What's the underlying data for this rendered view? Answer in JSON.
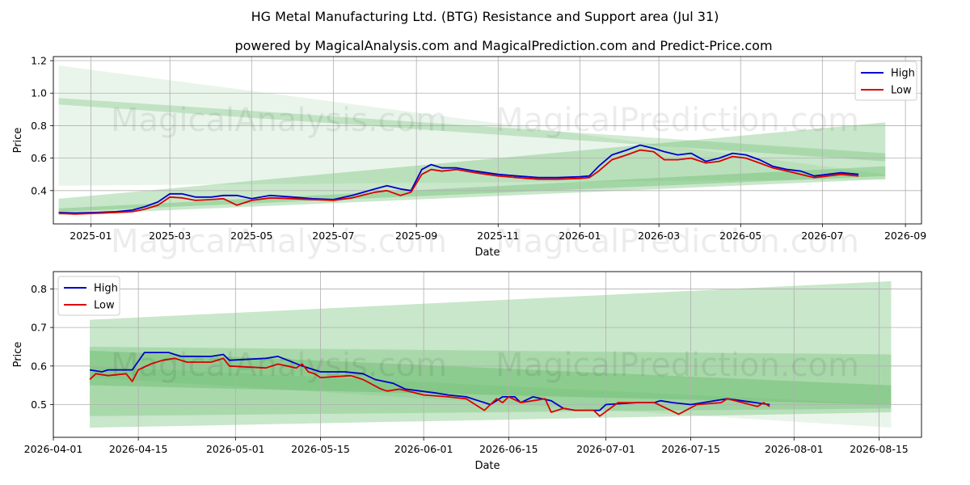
{
  "title": "HG Metal Manufacturing Ltd. (BTG) Resistance and Support area (Jul 31)",
  "subtitle": "powered by MagicalAnalysis.com and MagicalPrediction.com and Predict-Price.com",
  "watermarks": [
    "MagicalAnalysis.com",
    "MagicalPrediction.com"
  ],
  "colors": {
    "high": "#0000cc",
    "low": "#dd0000",
    "band": "#4caf50"
  },
  "chart_data": [
    {
      "type": "line",
      "xlabel": "Date",
      "ylabel": "Price",
      "xlim": [
        "2024-12-04",
        "2026-09-13"
      ],
      "ylim": [
        0.195,
        1.225
      ],
      "x_ticks": [
        "2025-01",
        "2025-03",
        "2025-05",
        "2025-07",
        "2025-09",
        "2025-11",
        "2026-01",
        "2026-03",
        "2026-05",
        "2026-07",
        "2026-09"
      ],
      "x_tick_dates": [
        "2025-01-01",
        "2025-03-01",
        "2025-05-01",
        "2025-07-01",
        "2025-09-01",
        "2025-11-01",
        "2026-01-01",
        "2026-03-01",
        "2026-05-01",
        "2026-07-01",
        "2026-09-01"
      ],
      "y_ticks": [
        0.4,
        0.6,
        0.8,
        1.0,
        1.2
      ],
      "y_tick_labels": [
        "0.4",
        "0.6",
        "0.8",
        "1.0",
        "1.2"
      ],
      "grid": true,
      "legend": "top-right",
      "bands": [
        {
          "start": "2024-12-08",
          "end": "2026-08-17",
          "top_start": 1.17,
          "top_end": 0.5,
          "bottom_start": 0.43,
          "bottom_end": 0.47,
          "opacity": 0.12
        },
        {
          "start": "2024-12-08",
          "end": "2026-08-17",
          "top_start": 0.97,
          "top_end": 0.63,
          "bottom_start": 0.93,
          "bottom_end": 0.58,
          "opacity": 0.25
        },
        {
          "start": "2024-12-08",
          "end": "2026-08-17",
          "top_start": 0.35,
          "top_end": 0.82,
          "bottom_start": 0.27,
          "bottom_end": 0.49,
          "opacity": 0.3
        },
        {
          "start": "2024-12-08",
          "end": "2026-08-17",
          "top_start": 0.29,
          "top_end": 0.55,
          "bottom_start": 0.25,
          "bottom_end": 0.47,
          "opacity": 0.3
        }
      ],
      "series": [
        {
          "name": "High",
          "x": [
            "2024-12-08",
            "2024-12-20",
            "2025-01-05",
            "2025-01-20",
            "2025-02-01",
            "2025-02-10",
            "2025-02-20",
            "2025-03-01",
            "2025-03-10",
            "2025-03-20",
            "2025-04-01",
            "2025-04-10",
            "2025-04-20",
            "2025-05-01",
            "2025-05-15",
            "2025-06-01",
            "2025-06-15",
            "2025-07-01",
            "2025-07-15",
            "2025-08-01",
            "2025-08-10",
            "2025-08-20",
            "2025-08-28",
            "2025-09-05",
            "2025-09-12",
            "2025-09-20",
            "2025-10-01",
            "2025-10-15",
            "2025-11-01",
            "2025-11-15",
            "2025-12-01",
            "2025-12-15",
            "2026-01-01",
            "2026-01-08",
            "2026-01-15",
            "2026-01-25",
            "2026-02-05",
            "2026-02-15",
            "2026-02-25",
            "2026-03-05",
            "2026-03-15",
            "2026-03-25",
            "2026-04-05",
            "2026-04-15",
            "2026-04-25",
            "2026-05-05",
            "2026-05-15",
            "2026-05-25",
            "2026-06-05",
            "2026-06-15",
            "2026-06-25",
            "2026-07-05",
            "2026-07-15",
            "2026-07-28"
          ],
          "values": [
            0.265,
            0.262,
            0.265,
            0.27,
            0.28,
            0.3,
            0.33,
            0.38,
            0.38,
            0.36,
            0.36,
            0.37,
            0.37,
            0.35,
            0.37,
            0.36,
            0.35,
            0.345,
            0.37,
            0.41,
            0.43,
            0.41,
            0.4,
            0.53,
            0.56,
            0.54,
            0.54,
            0.52,
            0.5,
            0.49,
            0.48,
            0.48,
            0.485,
            0.49,
            0.55,
            0.62,
            0.65,
            0.68,
            0.66,
            0.64,
            0.62,
            0.63,
            0.58,
            0.6,
            0.63,
            0.62,
            0.59,
            0.55,
            0.53,
            0.52,
            0.49,
            0.5,
            0.51,
            0.5
          ]
        },
        {
          "name": "Low",
          "x": [
            "2024-12-08",
            "2024-12-20",
            "2025-01-05",
            "2025-01-20",
            "2025-02-01",
            "2025-02-10",
            "2025-02-20",
            "2025-03-01",
            "2025-03-10",
            "2025-03-20",
            "2025-04-01",
            "2025-04-10",
            "2025-04-20",
            "2025-05-01",
            "2025-05-15",
            "2025-06-01",
            "2025-06-15",
            "2025-07-01",
            "2025-07-15",
            "2025-08-01",
            "2025-08-10",
            "2025-08-20",
            "2025-08-28",
            "2025-09-05",
            "2025-09-12",
            "2025-09-20",
            "2025-10-01",
            "2025-10-15",
            "2025-11-01",
            "2025-11-15",
            "2025-12-01",
            "2025-12-15",
            "2026-01-01",
            "2026-01-08",
            "2026-01-15",
            "2026-01-25",
            "2026-02-05",
            "2026-02-15",
            "2026-02-25",
            "2026-03-05",
            "2026-03-15",
            "2026-03-25",
            "2026-04-05",
            "2026-04-15",
            "2026-04-25",
            "2026-05-05",
            "2026-05-15",
            "2026-05-25",
            "2026-06-05",
            "2026-06-15",
            "2026-06-25",
            "2026-07-05",
            "2026-07-15",
            "2026-07-28"
          ],
          "values": [
            0.26,
            0.255,
            0.26,
            0.265,
            0.27,
            0.285,
            0.31,
            0.36,
            0.355,
            0.34,
            0.345,
            0.35,
            0.31,
            0.34,
            0.355,
            0.35,
            0.345,
            0.34,
            0.355,
            0.39,
            0.4,
            0.37,
            0.39,
            0.5,
            0.53,
            0.52,
            0.53,
            0.51,
            0.49,
            0.48,
            0.47,
            0.47,
            0.475,
            0.48,
            0.52,
            0.59,
            0.62,
            0.65,
            0.64,
            0.59,
            0.59,
            0.6,
            0.57,
            0.58,
            0.61,
            0.6,
            0.57,
            0.54,
            0.52,
            0.5,
            0.48,
            0.49,
            0.5,
            0.49
          ]
        }
      ]
    },
    {
      "type": "line",
      "xlabel": "Date",
      "ylabel": "Price",
      "xlim": [
        "2026-04-01",
        "2026-08-22"
      ],
      "ylim": [
        0.415,
        0.845
      ],
      "x_ticks": [
        "2026-04-01",
        "2026-04-15",
        "2026-05-01",
        "2026-05-15",
        "2026-06-01",
        "2026-06-15",
        "2026-07-01",
        "2026-07-15",
        "2026-08-01",
        "2026-08-15"
      ],
      "x_tick_dates": [
        "2026-04-01",
        "2026-04-15",
        "2026-05-01",
        "2026-05-15",
        "2026-06-01",
        "2026-06-15",
        "2026-07-01",
        "2026-07-15",
        "2026-08-01",
        "2026-08-15"
      ],
      "y_ticks": [
        0.5,
        0.6,
        0.7,
        0.8
      ],
      "y_tick_labels": [
        "0.5",
        "0.6",
        "0.7",
        "0.8"
      ],
      "grid": true,
      "legend": "top-left",
      "bands": [
        {
          "start": "2026-04-07",
          "end": "2026-08-17",
          "top_start": 0.72,
          "top_end": 0.82,
          "bottom_start": 0.44,
          "bottom_end": 0.48,
          "opacity": 0.3
        },
        {
          "start": "2026-04-07",
          "end": "2026-08-17",
          "top_start": 0.65,
          "top_end": 0.63,
          "bottom_start": 0.47,
          "bottom_end": 0.49,
          "opacity": 0.25
        },
        {
          "start": "2026-04-07",
          "end": "2026-08-17",
          "top_start": 0.64,
          "top_end": 0.55,
          "bottom_start": 0.55,
          "bottom_end": 0.5,
          "opacity": 0.3
        },
        {
          "start": "2026-04-07",
          "end": "2026-08-17",
          "top_start": 0.6,
          "top_end": 0.5,
          "bottom_start": 0.57,
          "bottom_end": 0.44,
          "opacity": 0.12
        }
      ],
      "series": [
        {
          "name": "High",
          "x": [
            "2026-04-07",
            "2026-04-09",
            "2026-04-10",
            "2026-04-14",
            "2026-04-16",
            "2026-04-20",
            "2026-04-22",
            "2026-04-27",
            "2026-04-29",
            "2026-04-30",
            "2026-05-06",
            "2026-05-08",
            "2026-05-12",
            "2026-05-15",
            "2026-05-19",
            "2026-05-22",
            "2026-05-24",
            "2026-05-27",
            "2026-05-29",
            "2026-06-03",
            "2026-06-05",
            "2026-06-08",
            "2026-06-10",
            "2026-06-12",
            "2026-06-14",
            "2026-06-15",
            "2026-06-16",
            "2026-06-17",
            "2026-06-19",
            "2026-06-22",
            "2026-06-23",
            "2026-06-24",
            "2026-06-26",
            "2026-06-30",
            "2026-07-01",
            "2026-07-06",
            "2026-07-09",
            "2026-07-10",
            "2026-07-12",
            "2026-07-15",
            "2026-07-21",
            "2026-07-28"
          ],
          "values": [
            0.59,
            0.585,
            0.59,
            0.59,
            0.635,
            0.635,
            0.625,
            0.625,
            0.63,
            0.615,
            0.62,
            0.625,
            0.6,
            0.585,
            0.585,
            0.58,
            0.565,
            0.555,
            0.54,
            0.53,
            0.525,
            0.52,
            0.51,
            0.5,
            0.52,
            0.52,
            0.52,
            0.505,
            0.52,
            0.51,
            0.5,
            0.49,
            0.485,
            0.485,
            0.5,
            0.505,
            0.505,
            0.51,
            0.505,
            0.5,
            0.515,
            0.5
          ]
        },
        {
          "name": "Low",
          "x": [
            "2026-04-07",
            "2026-04-08",
            "2026-04-10",
            "2026-04-13",
            "2026-04-14",
            "2026-04-15",
            "2026-04-17",
            "2026-04-19",
            "2026-04-21",
            "2026-04-23",
            "2026-04-27",
            "2026-04-29",
            "2026-04-30",
            "2026-05-06",
            "2026-05-08",
            "2026-05-11",
            "2026-05-12",
            "2026-05-13",
            "2026-05-14",
            "2026-05-15",
            "2026-05-20",
            "2026-05-22",
            "2026-05-25",
            "2026-05-26",
            "2026-05-28",
            "2026-06-01",
            "2026-06-05",
            "2026-06-08",
            "2026-06-09",
            "2026-06-11",
            "2026-06-13",
            "2026-06-14",
            "2026-06-15",
            "2026-06-17",
            "2026-06-21",
            "2026-06-22",
            "2026-06-24",
            "2026-06-26",
            "2026-06-29",
            "2026-06-30",
            "2026-07-03",
            "2026-07-09",
            "2026-07-13",
            "2026-07-16",
            "2026-07-20",
            "2026-07-21",
            "2026-07-26",
            "2026-07-27",
            "2026-07-28"
          ],
          "values": [
            0.565,
            0.58,
            0.575,
            0.58,
            0.56,
            0.59,
            0.605,
            0.615,
            0.62,
            0.61,
            0.61,
            0.62,
            0.6,
            0.595,
            0.605,
            0.595,
            0.605,
            0.585,
            0.58,
            0.57,
            0.575,
            0.565,
            0.54,
            0.535,
            0.54,
            0.525,
            0.52,
            0.515,
            0.505,
            0.485,
            0.515,
            0.505,
            0.52,
            0.505,
            0.515,
            0.48,
            0.49,
            0.485,
            0.485,
            0.47,
            0.505,
            0.505,
            0.475,
            0.5,
            0.505,
            0.515,
            0.495,
            0.505,
            0.495
          ]
        }
      ]
    }
  ]
}
